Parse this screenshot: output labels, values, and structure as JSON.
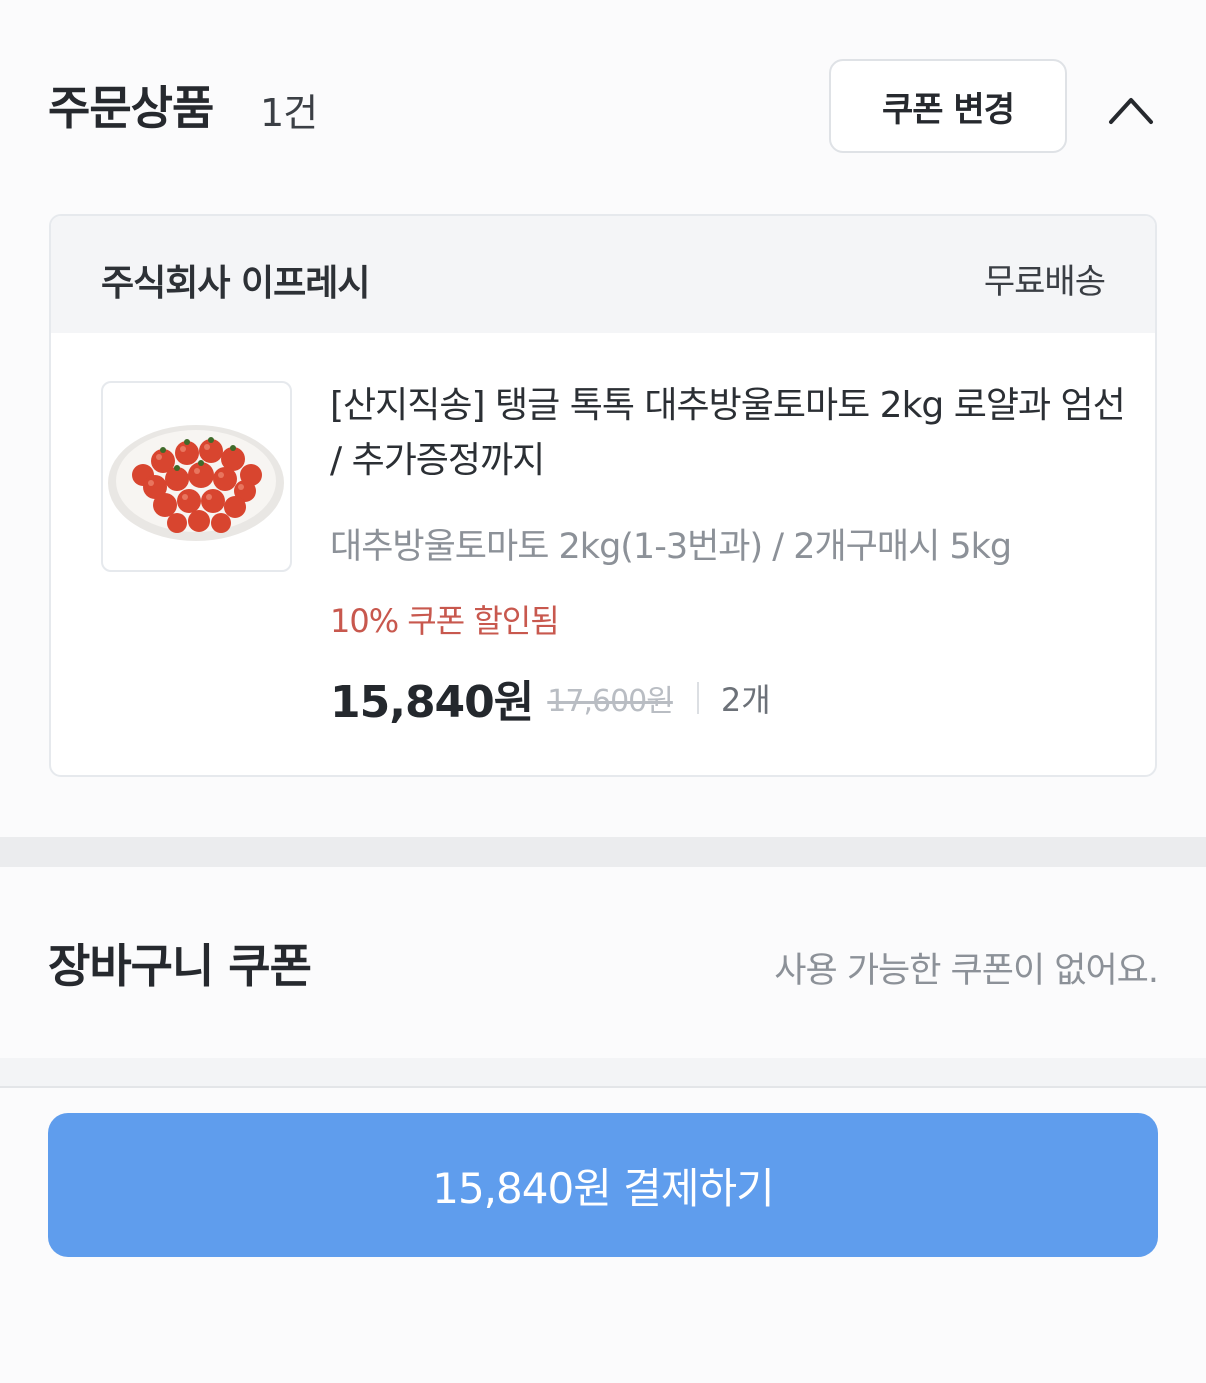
{
  "order": {
    "title": "주문상품",
    "count": "1건",
    "coupon_change_label": "쿠폰 변경",
    "collapse_icon": "chevron-up-icon"
  },
  "seller": {
    "name": "주식회사 이프레시",
    "shipping": "무료배송"
  },
  "product": {
    "name": "[산지직송] 탱글 톡톡 대추방울토마토 2kg 로얄과 엄선 / 추가증정까지",
    "option": "대추방울토마토 2kg(1-3번과) / 2개구매시 5kg",
    "coupon_applied": "10% 쿠폰 할인됨",
    "price": "15,840원",
    "original_price": "17,600원",
    "quantity": "2개",
    "image_icon": "cherry-tomatoes-plate-image"
  },
  "basket_coupon": {
    "title": "장바구니 쿠폰",
    "status": "사용 가능한 쿠폰이 없어요."
  },
  "checkout": {
    "button_label": "15,840원 결제하기"
  },
  "colors": {
    "accent": "#5f9ded",
    "discount": "#c8584e",
    "muted": "#8c9198"
  }
}
